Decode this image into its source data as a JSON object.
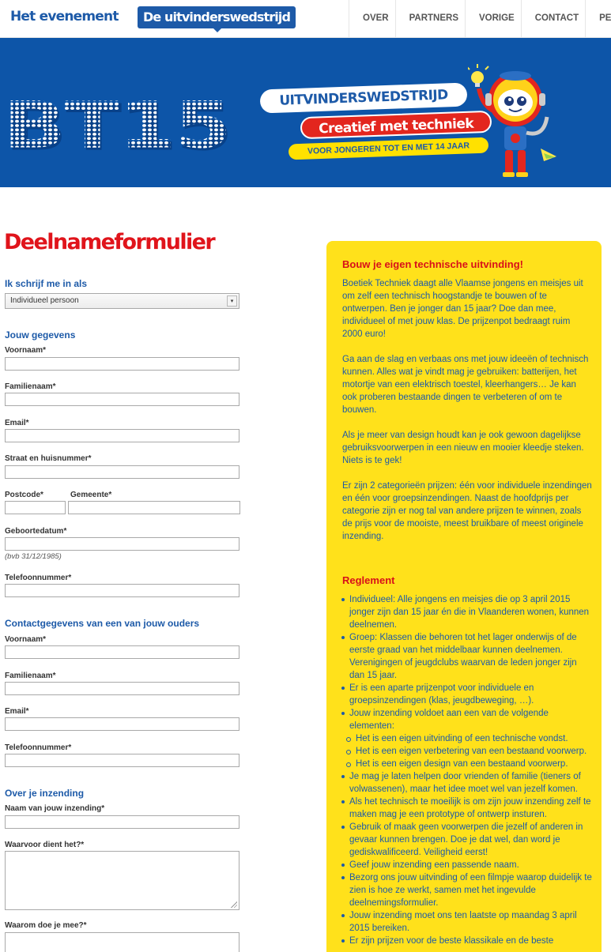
{
  "header": {
    "brand_event": "Het evenement",
    "brand_contest": "De uitvinderswedstrijd",
    "nav": [
      "OVER",
      "PARTNERS",
      "VORIGE EDITIES",
      "CONTACT",
      "PERS"
    ]
  },
  "banner": {
    "logo_text": "BT15",
    "tag1": "UITVINDERSWEDSTRIJD",
    "tag2": "Creatief met techniek",
    "tag3": "VOOR JONGEREN TOT EN MET 14 JAAR"
  },
  "form": {
    "title": "Deelnameformulier",
    "signup_heading": "Ik schrijf me in als",
    "signup_select": "Individueel persoon",
    "personal_heading": "Jouw gegevens",
    "firstname": "Voornaam*",
    "lastname": "Familienaam*",
    "email": "Email*",
    "street": "Straat en huisnummer*",
    "postcode": "Postcode*",
    "city": "Gemeente*",
    "birthdate": "Geboortedatum*",
    "birthdate_hint": "(bvb 31/12/1985)",
    "phone": "Telefoonnummer*",
    "parent_heading": "Contactgegevens van een van jouw ouders",
    "parent_firstname": "Voornaam*",
    "parent_lastname": "Familienaam*",
    "parent_email": "Email*",
    "parent_phone": "Telefoonnummer*",
    "entry_heading": "Over je inzending",
    "entry_name": "Naam van jouw inzending*",
    "entry_purpose": "Waarvoor dient het?*",
    "entry_why": "Waarom doe je mee?*"
  },
  "panel": {
    "title": "Bouw je eigen technische uitvinding!",
    "paragraphs": [
      "Boetiek Techniek daagt alle Vlaamse jongens en meisjes uit om zelf een technisch hoogstandje te bouwen of te ontwerpen. Ben je jonger dan 15 jaar? Doe dan mee, individueel of met jouw klas. De prijzenpot bedraagt ruim 2000 euro!",
      "Ga aan de slag en verbaas ons met jouw ideeën of technisch kunnen. Alles wat je vindt mag je gebruiken: batterijen, het motortje van een elektrisch toestel, kleerhangers… Je kan ook proberen bestaande dingen te verbeteren of om te bouwen.",
      "Als je meer van design houdt kan je ook gewoon dagelijkse gebruiksvoorwerpen in een nieuw en mooier kleedje steken. Niets is te gek!",
      "Er zijn 2 categorieën prijzen: één voor individuele inzendingen en één voor groepsinzendingen. Naast de hoofdprijs per categorie zijn er nog tal van andere prijzen te winnen, zoals de prijs voor de mooiste, meest bruikbare of meest originele inzending."
    ],
    "rules_title": "Reglement",
    "rules": [
      "Individueel: Alle jongens en meisjes die op 3 april 2015 jonger zijn dan 15 jaar én die in Vlaanderen wonen, kunnen deelnemen.",
      "Groep: Klassen die behoren tot het lager onderwijs of de eerste graad van het middelbaar kunnen deelnemen. Verenigingen of jeugdclubs waarvan de leden jonger zijn dan 15 jaar.",
      "Er is een aparte prijzenpot voor individuele en groepsinzendingen (klas, jeugdbeweging, …).",
      "Jouw inzending voldoet aan een van de volgende elementen:",
      "Het is een eigen uitvinding of een technische vondst.",
      "Het is een eigen verbetering van een bestaand voorwerp.",
      "Het is een eigen design van een bestaand voorwerp.",
      "Je mag je laten helpen door vrienden of familie (tieners of volwassenen), maar het idee moet wel van jezelf komen.",
      "Als het technisch te moeilijk is om zijn jouw inzending zelf te maken mag je een prototype of ontwerp insturen.",
      "Gebruik of maak geen voorwerpen die jezelf of anderen in gevaar kunnen brengen. Doe je dat wel, dan word je gediskwalificeerd. Veiligheid eerst!",
      "Geef jouw inzending een passende naam.",
      "Bezorg ons jouw uitvinding of een filmpje waarop duidelijk te zien is hoe ze werkt, samen met het ingevulde deelnemingsformulier.",
      "Jouw inzending moet ons ten laatste op maandag 3 april 2015 bereiken.",
      "Er zijn prijzen voor de beste klassikale en de beste"
    ]
  }
}
